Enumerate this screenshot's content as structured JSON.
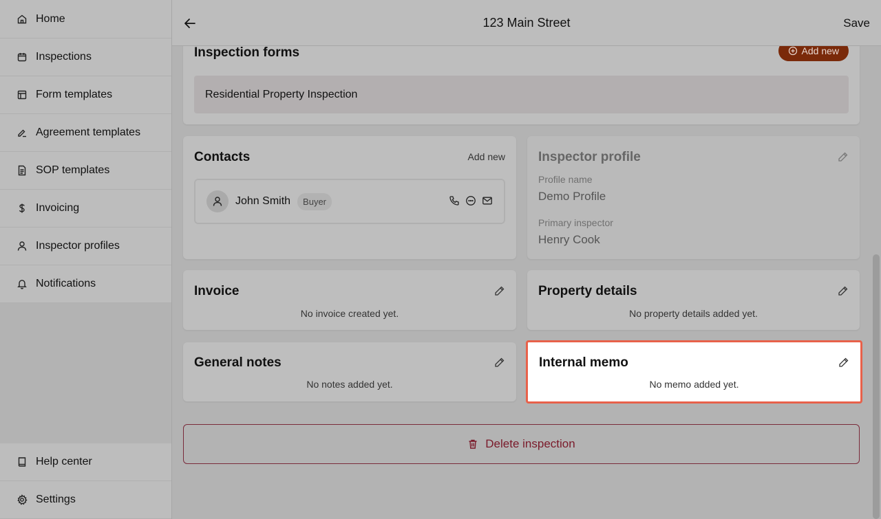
{
  "sidebar": {
    "items": [
      {
        "label": "Home",
        "icon": "home-icon"
      },
      {
        "label": "Inspections",
        "icon": "calendar-icon"
      },
      {
        "label": "Form templates",
        "icon": "layout-icon"
      },
      {
        "label": "Agreement templates",
        "icon": "signature-icon"
      },
      {
        "label": "SOP templates",
        "icon": "document-icon"
      },
      {
        "label": "Invoicing",
        "icon": "dollar-icon"
      },
      {
        "label": "Inspector profiles",
        "icon": "user-icon"
      },
      {
        "label": "Notifications",
        "icon": "bell-icon"
      }
    ],
    "bottom_items": [
      {
        "label": "Help center",
        "icon": "book-icon"
      },
      {
        "label": "Settings",
        "icon": "gear-icon"
      }
    ]
  },
  "header": {
    "title": "123 Main Street",
    "save_label": "Save"
  },
  "forms": {
    "title": "Inspection forms",
    "add_label": "Add new",
    "items": [
      "Residential Property Inspection"
    ]
  },
  "contacts": {
    "title": "Contacts",
    "add_label": "Add new",
    "items": [
      {
        "name": "John Smith",
        "role": "Buyer"
      }
    ]
  },
  "inspector_profile": {
    "title": "Inspector profile",
    "profile_name_label": "Profile name",
    "profile_name": "Demo Profile",
    "primary_inspector_label": "Primary inspector",
    "primary_inspector": "Henry Cook"
  },
  "invoice": {
    "title": "Invoice",
    "empty": "No invoice created yet."
  },
  "property_details": {
    "title": "Property details",
    "empty": "No property details added yet."
  },
  "general_notes": {
    "title": "General notes",
    "empty": "No notes added yet."
  },
  "internal_memo": {
    "title": "Internal memo",
    "empty": "No memo added yet."
  },
  "delete_label": "Delete inspection",
  "colors": {
    "accent": "#7a2a0a",
    "highlight_border": "#e8614a",
    "danger": "#7a1a2a"
  }
}
